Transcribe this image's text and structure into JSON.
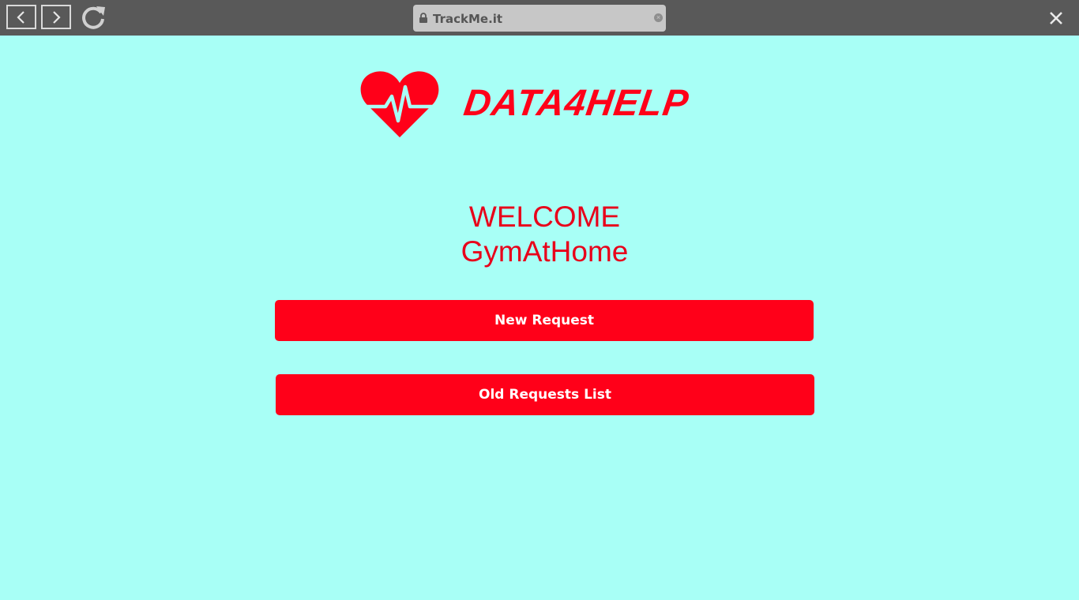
{
  "browser": {
    "url": "TrackMe.it",
    "back_icon": "chevron-left-icon",
    "forward_icon": "chevron-right-icon",
    "reload_icon": "reload-icon",
    "close_icon": "close-icon"
  },
  "brand": {
    "name": "DATA4HELP",
    "logo_icon": "heart-pulse-icon",
    "color": "#ff0019"
  },
  "welcome": {
    "line1": "WELCOME",
    "line2": "GymAtHome"
  },
  "actions": {
    "new_request": "New Request",
    "old_requests": "Old Requests List"
  },
  "colors": {
    "background": "#a8fff6",
    "topbar": "#595959",
    "accent": "#ff0019"
  }
}
